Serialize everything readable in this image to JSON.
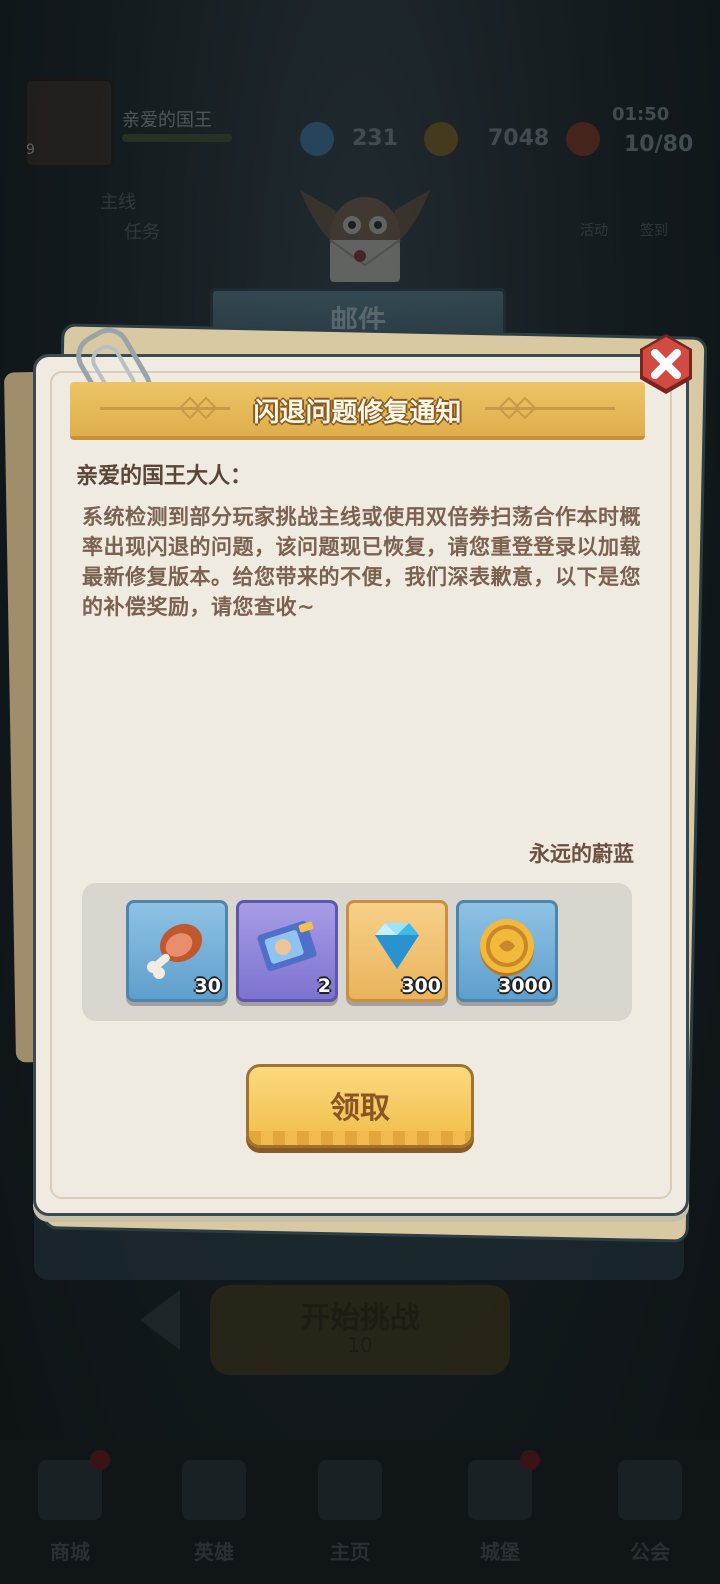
{
  "background": {
    "player_name": "亲爱的国王",
    "player_level": "9",
    "resources": [
      {
        "name": "gem",
        "value": "231"
      },
      {
        "name": "gold",
        "value": "7048"
      },
      {
        "name": "stamina",
        "value": "10/80",
        "timer": "01:50"
      }
    ],
    "side_left": [
      "主线",
      "任务"
    ],
    "side_right": [
      "活动",
      "签到"
    ],
    "mail_panel_title": "邮件",
    "start_button": {
      "label": "开始挑战",
      "cost": "10"
    },
    "bottom_nav": [
      "商城",
      "英雄",
      "主页",
      "城堡",
      "公会"
    ]
  },
  "mail": {
    "title": "闪退问题修复通知",
    "greeting": "亲爱的国王大人：",
    "body": "系统检测到部分玩家挑战主线或使用双倍券扫荡合作本时概率出现闪退的问题，该问题现已恢复，请您重登登录以加载最新修复版本。给您带来的不便，我们深表歉意，以下是您的补偿奖励，请您查收~",
    "signature": "永远的蔚蓝",
    "rewards": [
      {
        "icon": "meat-icon",
        "count": "30",
        "style": "blue"
      },
      {
        "icon": "ticket-icon",
        "count": "2",
        "style": "purple"
      },
      {
        "icon": "diamond-icon",
        "count": "300",
        "style": "gold"
      },
      {
        "icon": "gold-coin-icon",
        "count": "3000",
        "style": "blue"
      }
    ],
    "claim_label": "领取"
  },
  "colors": {
    "ribbon": "#e6ba5a",
    "panel": "#f0ebe0",
    "close": "#c9453e",
    "claim": "#f4c85a"
  }
}
